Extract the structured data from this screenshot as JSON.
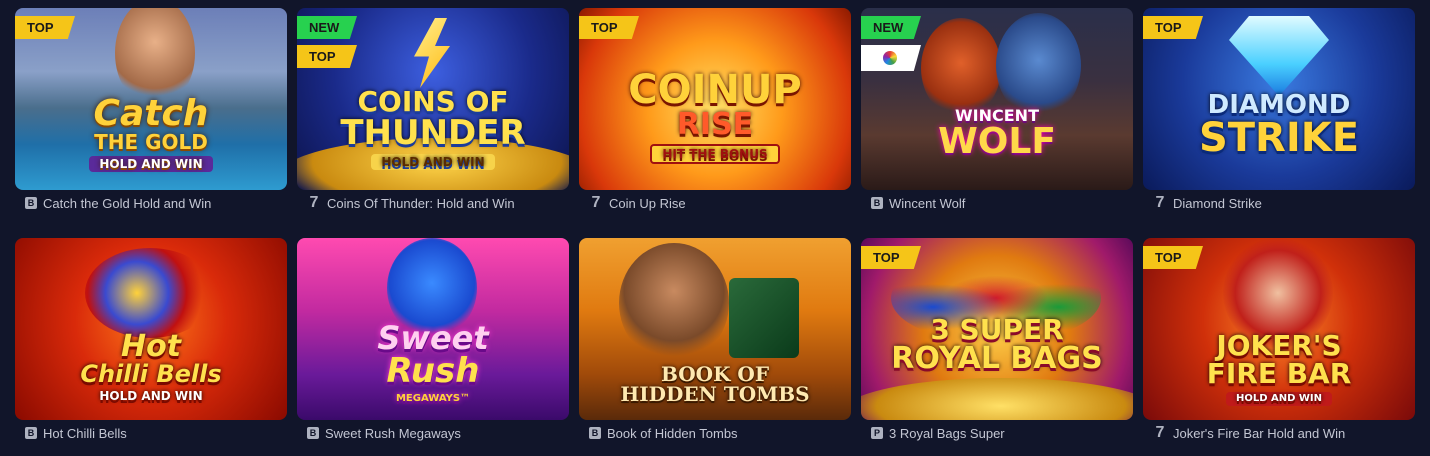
{
  "colors": {
    "background": "#11152a",
    "badge_top": "#f5c518",
    "badge_new": "#27d14f",
    "caption_text": "#c3c6d3"
  },
  "games": [
    {
      "name": "Catch the Gold Hold and Win",
      "provider_icon": "b-square-icon",
      "provider_glyph": "B",
      "badges": [
        "TOP"
      ],
      "art_line1": "Catch",
      "art_line2": "THE GOLD",
      "art_sub": "HOLD AND WIN"
    },
    {
      "name": "Coins Of Thunder: Hold and Win",
      "provider_icon": "seven-icon",
      "provider_glyph": "7",
      "badges": [
        "NEW",
        "TOP"
      ],
      "art_line1": "COINS OF",
      "art_line2": "THUNDER",
      "art_sub": "HOLD AND WIN"
    },
    {
      "name": "Coin Up Rise",
      "provider_icon": "seven-icon",
      "provider_glyph": "7",
      "badges": [
        "TOP"
      ],
      "art_line1": "COINUP",
      "art_line2": "RISE",
      "art_sub": "HIT THE BONUS"
    },
    {
      "name": "Wincent Wolf",
      "provider_icon": "b-square-icon",
      "provider_glyph": "B",
      "badges": [
        "NEW",
        "ring"
      ],
      "art_line1": "WINCENT",
      "art_line2": "WOLF",
      "art_sub": ""
    },
    {
      "name": "Diamond Strike",
      "provider_icon": "seven-icon",
      "provider_glyph": "7",
      "badges": [
        "TOP"
      ],
      "art_line1": "DIAMOND",
      "art_line2": "STRIKE",
      "art_sub": ""
    },
    {
      "name": "Hot Chilli Bells",
      "provider_icon": "b-square-icon",
      "provider_glyph": "B",
      "badges": [],
      "art_line1": "Hot",
      "art_line2": "Chilli Bells",
      "art_sub": "HOLD AND WIN"
    },
    {
      "name": "Sweet Rush Megaways",
      "provider_icon": "b-square-icon",
      "provider_glyph": "B",
      "badges": [],
      "art_line1": "Sweet",
      "art_line2": "Rush",
      "art_sub": "MEGAWAYS™"
    },
    {
      "name": "Book of Hidden Tombs",
      "provider_icon": "b-square-icon",
      "provider_glyph": "B",
      "badges": [],
      "art_line1": "BOOK OF",
      "art_line2": "HIDDEN TOMBS",
      "art_sub": ""
    },
    {
      "name": "3 Royal Bags Super",
      "provider_icon": "p-square-icon",
      "provider_glyph": "P",
      "badges": [
        "TOP"
      ],
      "art_line1": "3 SUPER",
      "art_line2": "ROYAL BAGS",
      "art_sub": ""
    },
    {
      "name": "Joker's Fire Bar Hold and Win",
      "provider_icon": "seven-icon",
      "provider_glyph": "7",
      "badges": [
        "TOP"
      ],
      "art_line1": "JOKER'S",
      "art_line2": "FIRE BAR",
      "art_sub": "HOLD AND WIN"
    }
  ]
}
